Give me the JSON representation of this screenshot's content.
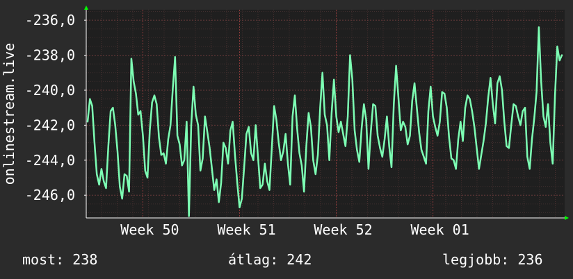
{
  "chart_data": {
    "type": "line",
    "ylabel": "onlinestream.live",
    "ylim": [
      -247.3,
      -235.4
    ],
    "y_ticks": [
      {
        "value": -236,
        "label": "-236,0"
      },
      {
        "value": -238,
        "label": "-238,0"
      },
      {
        "value": -240,
        "label": "-240,0"
      },
      {
        "value": -242,
        "label": "-242,0"
      },
      {
        "value": -244,
        "label": "-244,0"
      },
      {
        "value": -246,
        "label": "-246,0"
      }
    ],
    "x_ticks": [
      {
        "index": 24,
        "label": "Week 50"
      },
      {
        "index": 66,
        "label": "Week 51"
      },
      {
        "index": 108,
        "label": "Week 52"
      },
      {
        "index": 150,
        "label": "Week 01"
      }
    ],
    "grid": true,
    "series": [
      {
        "color": "#7dffb4",
        "values": [
          -241.8,
          -240.5,
          -240.9,
          -243.0,
          -244.8,
          -245.4,
          -244.5,
          -245.2,
          -245.6,
          -243.2,
          -241.2,
          -241.0,
          -242.0,
          -243.5,
          -245.5,
          -246.2,
          -244.8,
          -244.9,
          -245.8,
          -238.2,
          -239.5,
          -240.2,
          -241.4,
          -241.2,
          -242.6,
          -244.6,
          -245.0,
          -242.3,
          -240.7,
          -240.3,
          -240.8,
          -242.7,
          -243.7,
          -243.6,
          -244.2,
          -242.8,
          -242.0,
          -239.9,
          -238.1,
          -242.6,
          -243.1,
          -244.3,
          -244.0,
          -241.8,
          -247.2,
          -242.0,
          -239.8,
          -241.4,
          -242.0,
          -244.6,
          -243.9,
          -241.5,
          -242.4,
          -243.3,
          -244.5,
          -245.7,
          -245.1,
          -246.4,
          -245.3,
          -243.0,
          -243.3,
          -244.2,
          -242.3,
          -241.8,
          -243.7,
          -245.3,
          -246.7,
          -246.2,
          -244.4,
          -242.5,
          -242.1,
          -243.6,
          -244.0,
          -242.0,
          -243.8,
          -245.6,
          -245.4,
          -244.2,
          -245.2,
          -245.7,
          -243.3,
          -240.9,
          -241.7,
          -243.0,
          -244.0,
          -243.5,
          -242.5,
          -244.2,
          -245.4,
          -241.5,
          -240.3,
          -242.2,
          -243.6,
          -244.3,
          -245.8,
          -243.2,
          -241.3,
          -242.1,
          -244.0,
          -244.8,
          -243.7,
          -241.0,
          -239.0,
          -241.4,
          -242.0,
          -244.0,
          -241.3,
          -239.4,
          -241.5,
          -242.4,
          -241.8,
          -242.5,
          -243.2,
          -241.5,
          -238.0,
          -239.4,
          -242.3,
          -243.4,
          -244.1,
          -242.2,
          -240.8,
          -241.7,
          -244.5,
          -242.4,
          -240.8,
          -240.9,
          -242.6,
          -243.3,
          -243.8,
          -242.8,
          -241.5,
          -243.2,
          -244.4,
          -240.8,
          -238.6,
          -240.4,
          -242.3,
          -241.8,
          -242.1,
          -243.1,
          -242.6,
          -240.6,
          -239.6,
          -241.0,
          -242.4,
          -243.4,
          -243.8,
          -244.2,
          -241.2,
          -239.8,
          -241.5,
          -242.1,
          -242.6,
          -241.8,
          -240.1,
          -240.2,
          -241.0,
          -242.7,
          -243.9,
          -244.0,
          -244.5,
          -242.8,
          -241.8,
          -242.9,
          -241.0,
          -240.3,
          -240.5,
          -241.2,
          -242.1,
          -243.3,
          -244.5,
          -243.7,
          -242.9,
          -241.9,
          -240.4,
          -239.3,
          -240.8,
          -241.9,
          -239.6,
          -239.2,
          -240.0,
          -241.8,
          -243.2,
          -243.3,
          -242.0,
          -240.8,
          -240.9,
          -241.5,
          -242.0,
          -241.2,
          -241.0,
          -243.8,
          -244.5,
          -242.8,
          -241.6,
          -240.1,
          -236.4,
          -239.5,
          -241.5,
          -242.1,
          -240.8,
          -243.0,
          -244.2,
          -240.3,
          -237.5,
          -238.3,
          -238.0
        ]
      }
    ]
  },
  "stats": {
    "now": "most: 238",
    "avg": "átlag: 242",
    "best": "legjobb: 236"
  },
  "colors": {
    "background": "#2b2b2b",
    "plot_background": "#1f1f1f",
    "grid": "#5a3a3a",
    "axis": "#ffffff",
    "arrow": "#00ff00",
    "line": "#7dffb4"
  }
}
